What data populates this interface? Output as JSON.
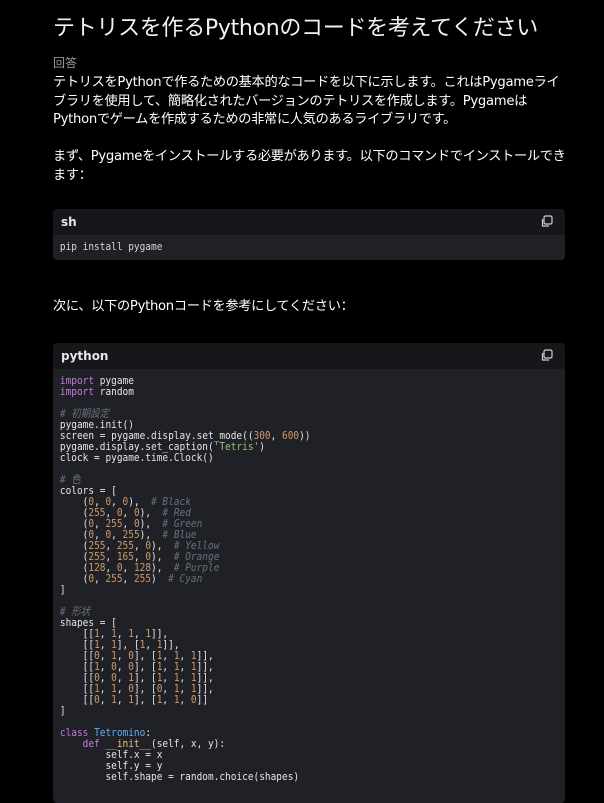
{
  "page": {
    "title": "テトリスを作るPythonのコードを考えてください",
    "answer_label": "回答",
    "para1": "テトリスをPythonで作るための基本的なコードを以下に示します。これはPygameライブラリを使用して、簡略化されたバージョンのテトリスを作成します。PygameはPythonでゲームを作成するための非常に人気のあるライブラリです。",
    "para2": "まず、Pygameをインストールする必要があります。以下のコマンドでインストールできます：",
    "para3": "次に、以下のPythonコードを参考にしてください："
  },
  "code_blocks": [
    {
      "language": "sh",
      "code": "pip install pygame"
    },
    {
      "language": "python",
      "lines": [
        "import pygame",
        "import random",
        "",
        "# 初期設定",
        "pygame.init()",
        "screen = pygame.display.set_mode((300, 600))",
        "pygame.display.set_caption('Tetris')",
        "clock = pygame.time.Clock()",
        "",
        "# 色",
        "colors = [",
        "    (0, 0, 0),  # Black",
        "    (255, 0, 0),  # Red",
        "    (0, 255, 0),  # Green",
        "    (0, 0, 255),  # Blue",
        "    (255, 255, 0),  # Yellow",
        "    (255, 165, 0),  # Orange",
        "    (128, 0, 128),  # Purple",
        "    (0, 255, 255)  # Cyan",
        "]",
        "",
        "# 形状",
        "shapes = [",
        "    [[1, 1, 1, 1]],",
        "    [[1, 1], [1, 1]],",
        "    [[0, 1, 0], [1, 1, 1]],",
        "    [[1, 0, 0], [1, 1, 1]],",
        "    [[0, 0, 1], [1, 1, 1]],",
        "    [[1, 1, 0], [0, 1, 1]],",
        "    [[0, 1, 1], [1, 1, 0]]",
        "]",
        "",
        "class Tetromino:",
        "    def __init__(self, x, y):",
        "        self.x = x",
        "        self.y = y",
        "        self.shape = random.choice(shapes)"
      ]
    }
  ],
  "icons": {
    "copy": "copy-icon"
  }
}
